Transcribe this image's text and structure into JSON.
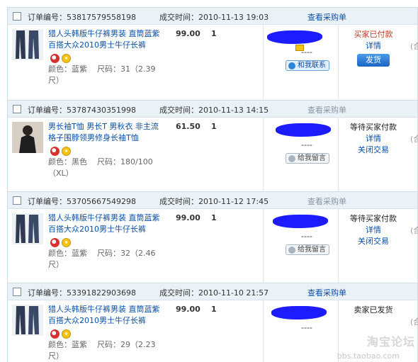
{
  "labels": {
    "order_no_prefix": "订单编号：",
    "time_prefix": "成交时间：",
    "view_po": "查看采购单",
    "attr_color": "颜色：",
    "attr_size": "尺码：",
    "dash": "----",
    "ww_online": "和我联系",
    "ww_offline": "给我留言",
    "details": "详情",
    "close_trade": "关闭交易",
    "ship": "发货",
    "cut_off": "(合"
  },
  "orders": [
    {
      "order_no": "53817579558198",
      "time": "2010-11-13 19:03",
      "title": "猎人头韩版牛仔裤男装 直筒蓝紫百搭大众2010男士牛仔长裤",
      "color": "蓝紫",
      "size": "31（2.39尺）",
      "price": "99.00",
      "qty": "1",
      "ww": "和我联系",
      "status": "买家已付款",
      "links": [
        "详情"
      ],
      "button": "发货"
    },
    {
      "order_no": "53787430351998",
      "time": "2010-11-13 14:15",
      "title": "男长袖T恤 男长T 男秋衣 非主流格子围脖领男修身长袖T恤",
      "color": "黑色",
      "size": "180/100（XL）",
      "price": "61.50",
      "qty": "1",
      "ww": "给我留言",
      "status": "等待买家付款",
      "links": [
        "详情",
        "关闭交易"
      ]
    },
    {
      "order_no": "53705667549298",
      "time": "2010-11-12 17:45",
      "title": "猎人头韩版牛仔裤男装 直筒蓝紫百搭大众2010男士牛仔长裤",
      "color": "蓝紫",
      "size": "32（2.46尺）",
      "price": "99.00",
      "qty": "1",
      "ww": "给我留言",
      "status": "等待买家付款",
      "links": [
        "详情",
        "关闭交易"
      ]
    },
    {
      "order_no": "53391822903698",
      "time": "2010-11-10 21:57",
      "title": "猎人头韩版牛仔裤男装 直筒蓝紫百搭大众2010男士牛仔长裤",
      "color": "蓝紫",
      "size": "29（2.23尺）",
      "price": "99.00",
      "qty": "1",
      "ww": "",
      "status": "卖家已发货",
      "links": []
    }
  ],
  "watermark": "淘宝论坛",
  "watermark_sub": "bbs.taobao.com",
  "colors": {
    "link": "#0b4fa8",
    "header_bg": "#eaf2f8",
    "status_red": "#c0392b",
    "button_blue": "#1a64c4"
  }
}
